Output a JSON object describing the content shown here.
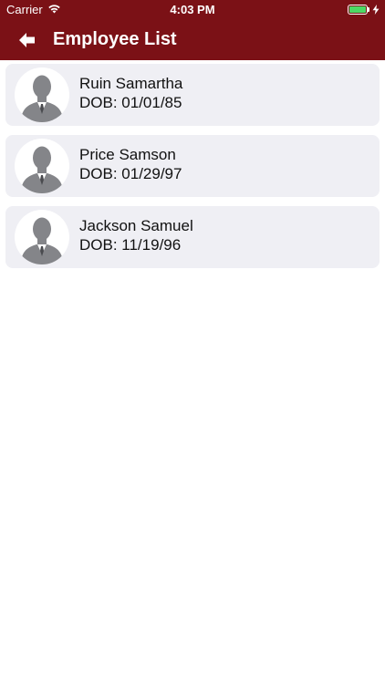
{
  "status_bar": {
    "carrier": "Carrier",
    "time": "4:03 PM",
    "battery_color": "#4cd964",
    "icons": [
      "wifi-icon",
      "battery-icon",
      "charging-bolt-icon"
    ]
  },
  "nav": {
    "title": "Employee List",
    "back_icon": "back-arrow-icon",
    "background_color": "#7b1116"
  },
  "employees": [
    {
      "name": "Ruin Samartha",
      "dob": "DOB: 01/01/85",
      "avatar_icon": "person-silhouette-icon"
    },
    {
      "name": "Price Samson",
      "dob": "DOB: 01/29/97",
      "avatar_icon": "person-silhouette-icon"
    },
    {
      "name": "Jackson Samuel",
      "dob": "DOB: 11/19/96",
      "avatar_icon": "person-silhouette-icon"
    }
  ]
}
